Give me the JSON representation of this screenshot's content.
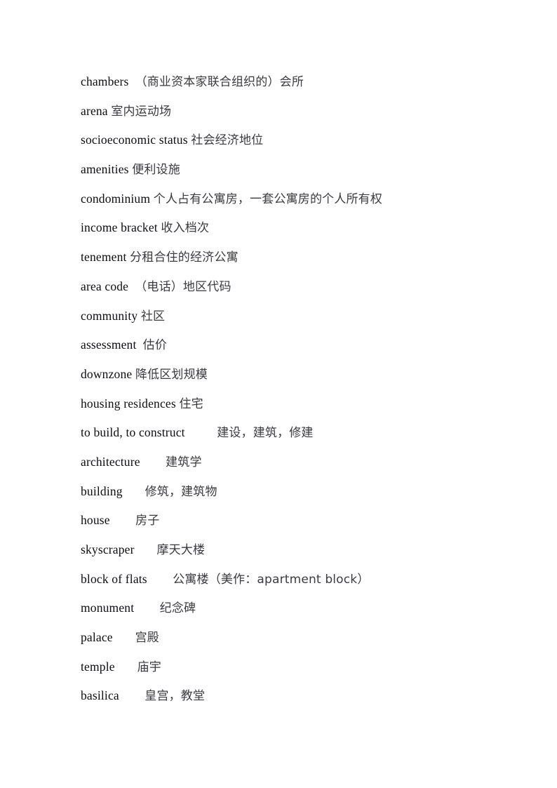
{
  "document": {
    "type": "vocabulary-glossary",
    "language_pair": "English-Chinese",
    "page_background": "#ffffff",
    "text_color": "#0d0d12",
    "gloss_color": "#3a3a40",
    "entry_count": 21
  },
  "entries": [
    {
      "term": "chambers",
      "sep": "  ",
      "gloss": "（商业资本家联合组织的）会所"
    },
    {
      "term": "arena",
      "sep": " ",
      "gloss": "室内运动场"
    },
    {
      "term": "socioeconomic status",
      "sep": " ",
      "gloss": "社会经济地位"
    },
    {
      "term": "amenities",
      "sep": " ",
      "gloss": "便利设施"
    },
    {
      "term": "condominium",
      "sep": " ",
      "gloss": "个人占有公寓房，一套公寓房的个人所有权"
    },
    {
      "term": "income bracket",
      "sep": " ",
      "gloss": "收入档次"
    },
    {
      "term": "tenement",
      "sep": " ",
      "gloss": "分租合住的经济公寓"
    },
    {
      "term": "area code",
      "sep": "  ",
      "gloss": "（电话）地区代码"
    },
    {
      "term": "community",
      "sep": " ",
      "gloss": "社区"
    },
    {
      "term": "assessment",
      "sep": "  ",
      "gloss": "估价"
    },
    {
      "term": "downzone",
      "sep": " ",
      "gloss": "降低区划规模"
    },
    {
      "term": "housing residences",
      "sep": " ",
      "gloss": "住宅"
    },
    {
      "term": "to build, to construct",
      "sep": "          ",
      "gloss": "建设，建筑，修建"
    },
    {
      "term": "architecture",
      "sep": "        ",
      "gloss": "建筑学"
    },
    {
      "term": "building",
      "sep": "       ",
      "gloss": "修筑，建筑物"
    },
    {
      "term": "house",
      "sep": "        ",
      "gloss": "房子"
    },
    {
      "term": "skyscraper",
      "sep": "       ",
      "gloss": "摩天大楼"
    },
    {
      "term": "block of flats",
      "sep": "        ",
      "gloss": "公寓楼（美作：apartment block）"
    },
    {
      "term": "monument",
      "sep": "        ",
      "gloss": "纪念碑"
    },
    {
      "term": "palace",
      "sep": "       ",
      "gloss": "宫殿"
    },
    {
      "term": "temple",
      "sep": "       ",
      "gloss": "庙宇"
    },
    {
      "term": "basilica",
      "sep": "        ",
      "gloss": "皇宫，教堂"
    }
  ]
}
